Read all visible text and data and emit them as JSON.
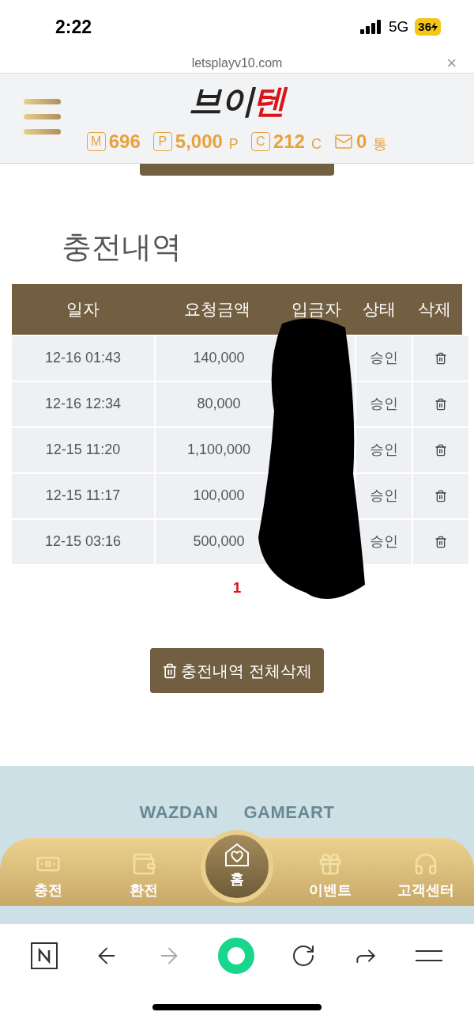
{
  "status_bar": {
    "time": "2:22",
    "network": "5G",
    "battery": "36"
  },
  "url_bar": {
    "url": "letsplayv10.com",
    "close": "×"
  },
  "header": {
    "logo_dark": "브이",
    "logo_red": "텐",
    "balances": [
      {
        "kind": "money",
        "icon": "M",
        "value": "696"
      },
      {
        "kind": "point",
        "icon": "P",
        "value": "5,000",
        "unit": "P"
      },
      {
        "kind": "coin",
        "icon": "C",
        "value": "212",
        "unit": "C"
      },
      {
        "kind": "mail",
        "value": "0",
        "unit": "통"
      }
    ]
  },
  "page_title": "충전내역",
  "table": {
    "columns": [
      "일자",
      "요청금액",
      "입금자",
      "상태",
      "삭제"
    ],
    "rows": [
      {
        "date": "12-16 01:43",
        "amount": "140,000",
        "status": "승인"
      },
      {
        "date": "12-16 12:34",
        "amount": "80,000",
        "status": "승인"
      },
      {
        "date": "12-15 11:20",
        "amount": "1,100,000",
        "status": "승인"
      },
      {
        "date": "12-15 11:17",
        "amount": "100,000",
        "status": "승인"
      },
      {
        "date": "12-15 03:16",
        "amount": "500,000",
        "status": "승인"
      }
    ]
  },
  "pagination": [
    {
      "label": "1",
      "selected": true
    }
  ],
  "delete_all_button": "충전내역 전체삭제",
  "partners": [
    "WAZDAN",
    "GAMEART"
  ],
  "bottom_nav": [
    {
      "kind": "charge",
      "label": "충전"
    },
    {
      "kind": "exchange",
      "label": "환전"
    },
    {
      "kind": "home",
      "label": "홈"
    },
    {
      "kind": "event",
      "label": "이벤트"
    },
    {
      "kind": "support",
      "label": "고객센터"
    }
  ]
}
